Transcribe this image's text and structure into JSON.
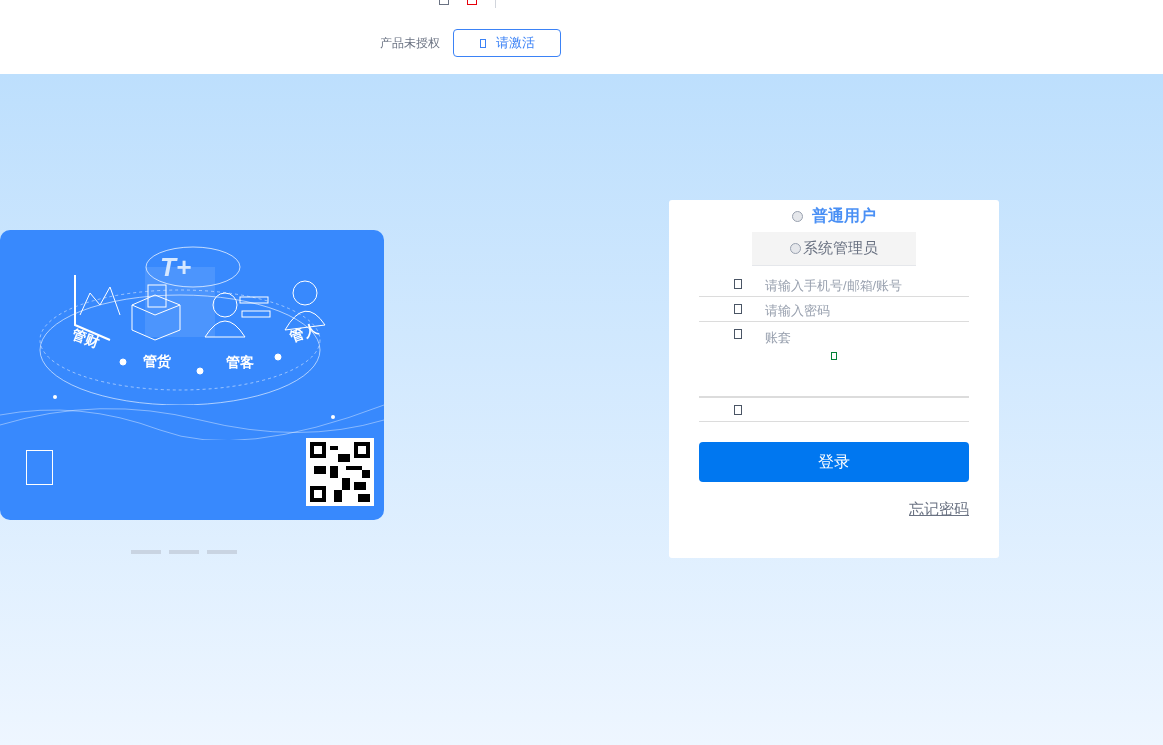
{
  "header": {
    "license_status": "产品未授权",
    "activate_button": "请激活"
  },
  "banner": {
    "logo": "T+",
    "features": [
      "管财",
      "管货",
      "管客",
      "管人"
    ]
  },
  "login": {
    "roles": [
      {
        "label": "普通用户",
        "selected": true
      },
      {
        "label": "系统管理员",
        "selected": false
      }
    ],
    "fields": [
      {
        "kind": "text",
        "placeholder": "请输入手机号/邮箱/账号"
      },
      {
        "kind": "password",
        "placeholder": "请输入密码"
      },
      {
        "kind": "select",
        "placeholder": "账套"
      },
      {
        "kind": "blank"
      }
    ],
    "submit": "登录",
    "forgot_password": "忘记密码"
  }
}
